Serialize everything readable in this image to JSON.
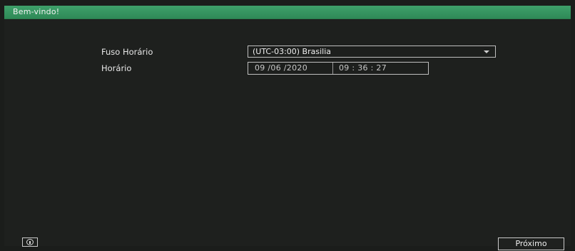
{
  "window": {
    "title": "Bem-vindo!"
  },
  "form": {
    "timezone_label": "Fuso Horário",
    "timezone_value": "(UTC-03:00) Brasilia",
    "time_label": "Horário",
    "date_value": "09 /06 /2020",
    "time_value": "09 : 36 : 27"
  },
  "footer": {
    "info_icon": "info-icon",
    "next_label": "Próximo"
  },
  "colors": {
    "titlebar": "#339458",
    "background": "#1e201e",
    "border": "#bfbfbf"
  }
}
